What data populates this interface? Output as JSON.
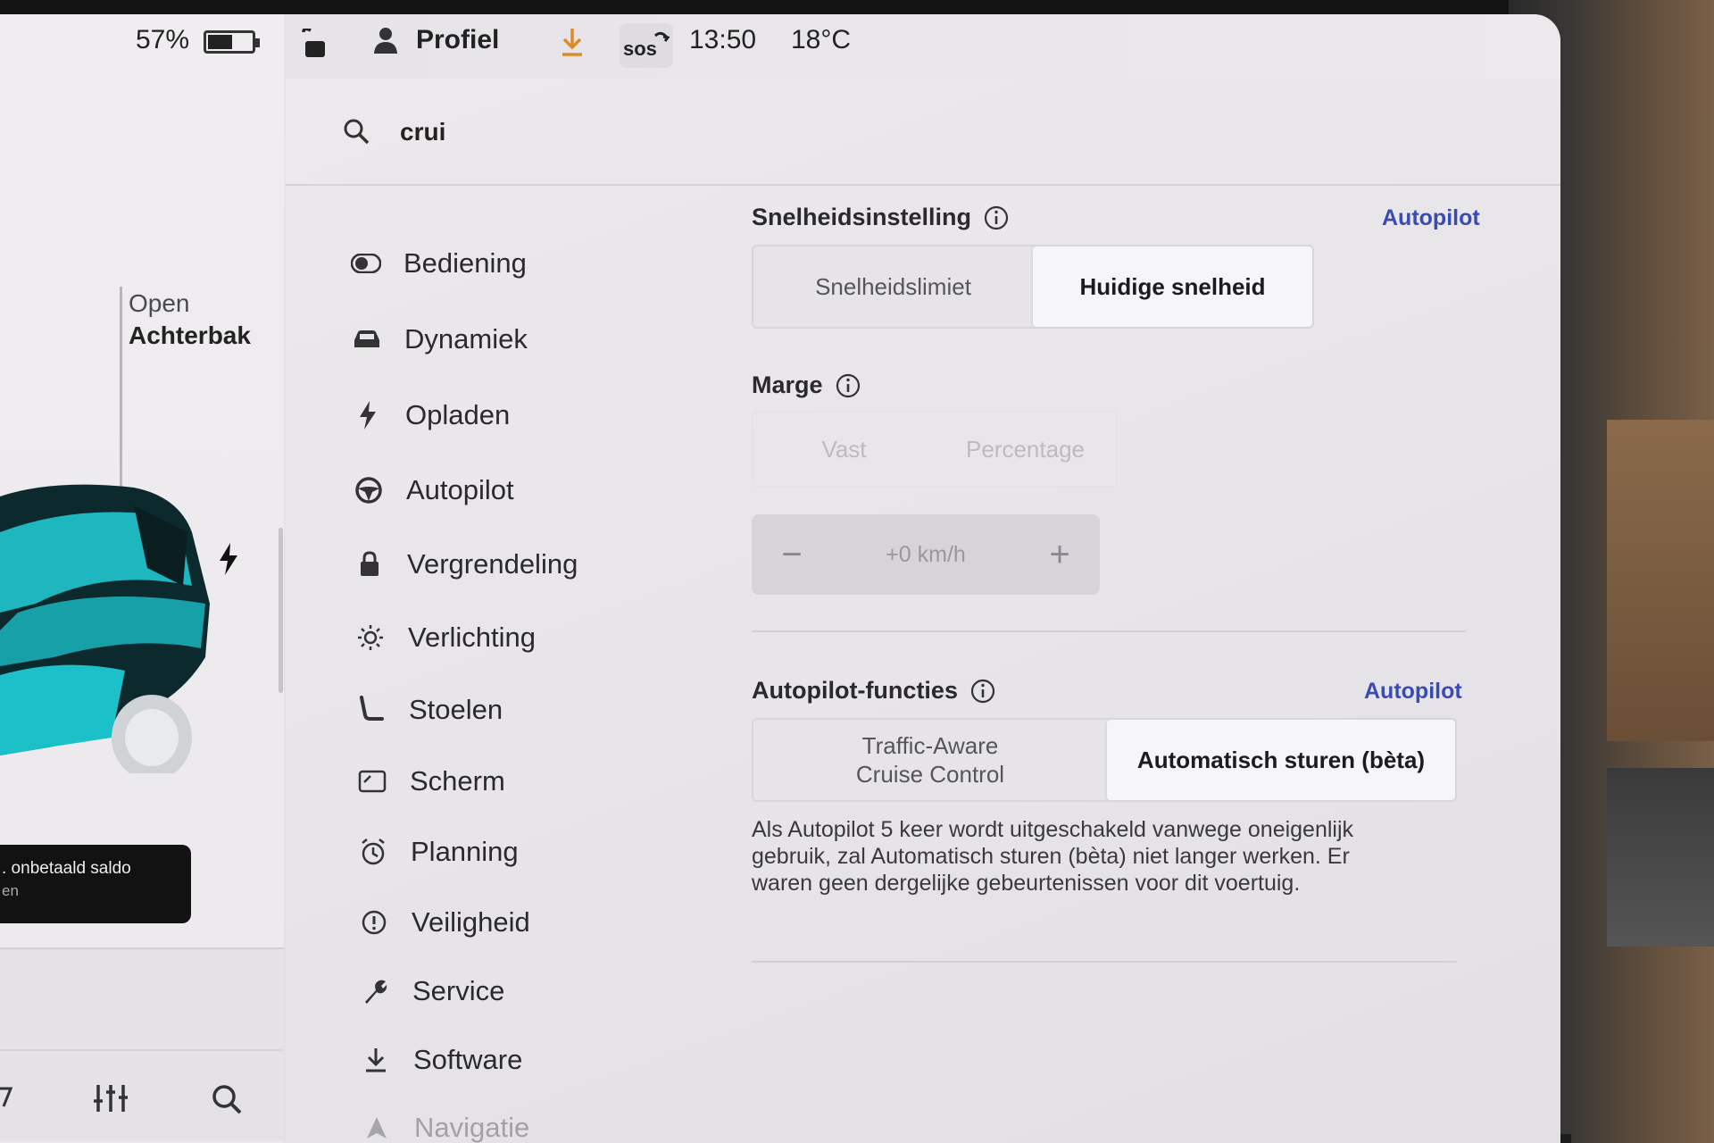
{
  "status_bar": {
    "battery_percent_label": "57%",
    "battery_level": 0.57,
    "profile_label": "Profiel",
    "sos_label": "sos",
    "time": "13:50",
    "temperature": "18°C"
  },
  "car_panel": {
    "trunk_open_label": "Open",
    "trunk_name_label": "Achterbak",
    "toast_text": ". onbetaald saldo",
    "toast_subtext": "en"
  },
  "search": {
    "query": "crui"
  },
  "menu": {
    "items": [
      {
        "label": "Bediening",
        "icon": "toggle-icon"
      },
      {
        "label": "Dynamiek",
        "icon": "car-icon"
      },
      {
        "label": "Opladen",
        "icon": "bolt-icon"
      },
      {
        "label": "Autopilot",
        "icon": "steering-wheel-icon"
      },
      {
        "label": "Vergrendeling",
        "icon": "lock-icon"
      },
      {
        "label": "Verlichting",
        "icon": "sun-icon"
      },
      {
        "label": "Stoelen",
        "icon": "seat-icon"
      },
      {
        "label": "Scherm",
        "icon": "screen-icon"
      },
      {
        "label": "Planning",
        "icon": "alarm-clock-icon"
      },
      {
        "label": "Veiligheid",
        "icon": "alert-circle-icon"
      },
      {
        "label": "Service",
        "icon": "wrench-icon"
      },
      {
        "label": "Software",
        "icon": "download-icon"
      },
      {
        "label": "Navigatie",
        "icon": "navigation-icon"
      }
    ]
  },
  "speed_setting": {
    "title": "Snelheidsinstelling",
    "link": "Autopilot",
    "options": [
      "Snelheidslimiet",
      "Huidige snelheid"
    ],
    "selected": "Huidige snelheid"
  },
  "margin": {
    "title": "Marge",
    "options": [
      "Vast",
      "Percentage"
    ],
    "value": "+0 km/h",
    "minus": "−",
    "plus": "+"
  },
  "autopilot_features": {
    "title": "Autopilot-functies",
    "link": "Autopilot",
    "option_1_line_1": "Traffic-Aware",
    "option_1_line_2": "Cruise Control",
    "option_2": "Automatisch sturen (bèta)",
    "selected": "Automatisch sturen (bèta)",
    "note_line_1": "Als Autopilot 5 keer wordt uitgeschakeld vanwege oneigenlijk",
    "note_line_2": "gebruik, zal Automatisch sturen (bèta) niet langer werken. Er",
    "note_line_3": "waren geen dergelijke gebeurtenissen voor dit voertuig."
  },
  "colors": {
    "link_blue": "#3a4cb0",
    "download_orange": "#e08a2a",
    "car_teal": "#1fb7bf"
  }
}
